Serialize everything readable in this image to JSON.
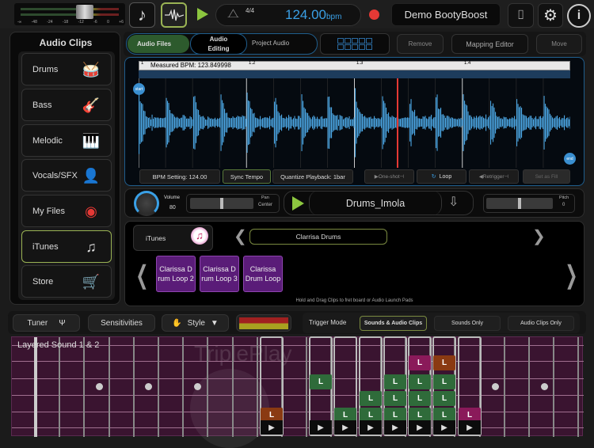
{
  "topbar": {
    "meter_scale": [
      "-∞",
      "-48",
      "-24",
      "-18",
      "-12",
      "-6",
      "0",
      "+6"
    ],
    "time_signature": "4/4",
    "tempo_value": "124.00",
    "tempo_unit": "bpm",
    "project_name": "Demo BootyBoost"
  },
  "sidebar": {
    "title": "Audio Clips",
    "items": [
      {
        "label": "Drums",
        "icon": "drum-kit-icon"
      },
      {
        "label": "Bass",
        "icon": "bass-guitar-icon"
      },
      {
        "label": "Melodic",
        "icon": "keyboard-icon"
      },
      {
        "label": "Vocals/SFX",
        "icon": "vocalist-icon"
      },
      {
        "label": "My Files",
        "icon": "record-icon"
      },
      {
        "label": "iTunes",
        "icon": "itunes-icon",
        "selected": true
      },
      {
        "label": "Store",
        "icon": "cart-icon"
      }
    ]
  },
  "toolbar": {
    "tabs": [
      "Audio Files",
      "Audio\nEditing",
      "Project Audio"
    ],
    "remove": "Remove",
    "mapping_editor": "Mapping Editor",
    "move": "Move"
  },
  "editor": {
    "measured_bpm": "Measured BPM: 123.849998",
    "bar_markers": [
      "1",
      "1.2",
      "1.3",
      "1.4"
    ],
    "start": "start",
    "end": "end",
    "bpm_setting": "BPM Setting: 124.00",
    "sync_tempo": "Sync Tempo",
    "quantize": "Quantize Playback: 1bar",
    "one_shot": "One-shot",
    "loop": "Loop",
    "retrigger": "Retrigger",
    "set_as_fill": "Set as Fill",
    "playhead_fraction": 0.6
  },
  "controls": {
    "volume_label": "Volume",
    "volume_value": "80",
    "pan_label": "Pan",
    "pan_value": "Center",
    "clip_name": "Drums_Imola",
    "pitch_label": "Pitch",
    "pitch_value": "0"
  },
  "browser": {
    "source": "iTunes",
    "folder": "Clarrisa Drums",
    "clips": [
      "Clarissa D rum Loop 2",
      "Clarissa D rum Loop 3",
      "Clarissa Drum Loop"
    ],
    "hint": "Hold and Drag Clips to fret board or Audio Launch Pads"
  },
  "bottombar": {
    "tuner": "Tuner",
    "sensitivities": "Sensitivities",
    "style": "Style",
    "trigger_mode": "Trigger Mode",
    "modes": [
      "Sounds & Audio Clips",
      "Sounds Only",
      "Audio Clips Only"
    ],
    "selected_mode": 0
  },
  "fretboard": {
    "sound_name": "Layered Sound 1 & 2",
    "watermark": "TriplePlay Connect",
    "pad_label": "L",
    "play_label": "▶",
    "colors": {
      "green": "#2f6b3a",
      "orange": "#8a3a12",
      "pink": "#8a1a5a"
    },
    "columns": [
      {
        "pads": [
          {
            "string": 4,
            "color": "orange"
          }
        ]
      },
      {
        "pads": [
          {
            "string": 2,
            "color": "green"
          }
        ]
      },
      {
        "pads": [
          {
            "string": 4,
            "color": "green"
          }
        ]
      },
      {
        "pads": [
          {
            "string": 3,
            "color": "green"
          },
          {
            "string": 4,
            "color": "green"
          }
        ]
      },
      {
        "pads": [
          {
            "string": 2,
            "color": "green"
          },
          {
            "string": 3,
            "color": "green"
          },
          {
            "string": 4,
            "color": "green"
          }
        ]
      },
      {
        "pads": [
          {
            "string": 1,
            "color": "pink"
          },
          {
            "string": 2,
            "color": "green"
          },
          {
            "string": 3,
            "color": "green"
          },
          {
            "string": 4,
            "color": "green"
          }
        ]
      },
      {
        "pads": [
          {
            "string": 1,
            "color": "orange"
          },
          {
            "string": 2,
            "color": "green"
          },
          {
            "string": 3,
            "color": "green"
          },
          {
            "string": 4,
            "color": "green"
          }
        ]
      },
      {
        "pads": [
          {
            "string": 4,
            "color": "pink"
          }
        ]
      }
    ]
  },
  "colors": {
    "accent_blue": "#3aa0e6",
    "accent_green": "#8cc63f",
    "record_red": "#e53935"
  }
}
